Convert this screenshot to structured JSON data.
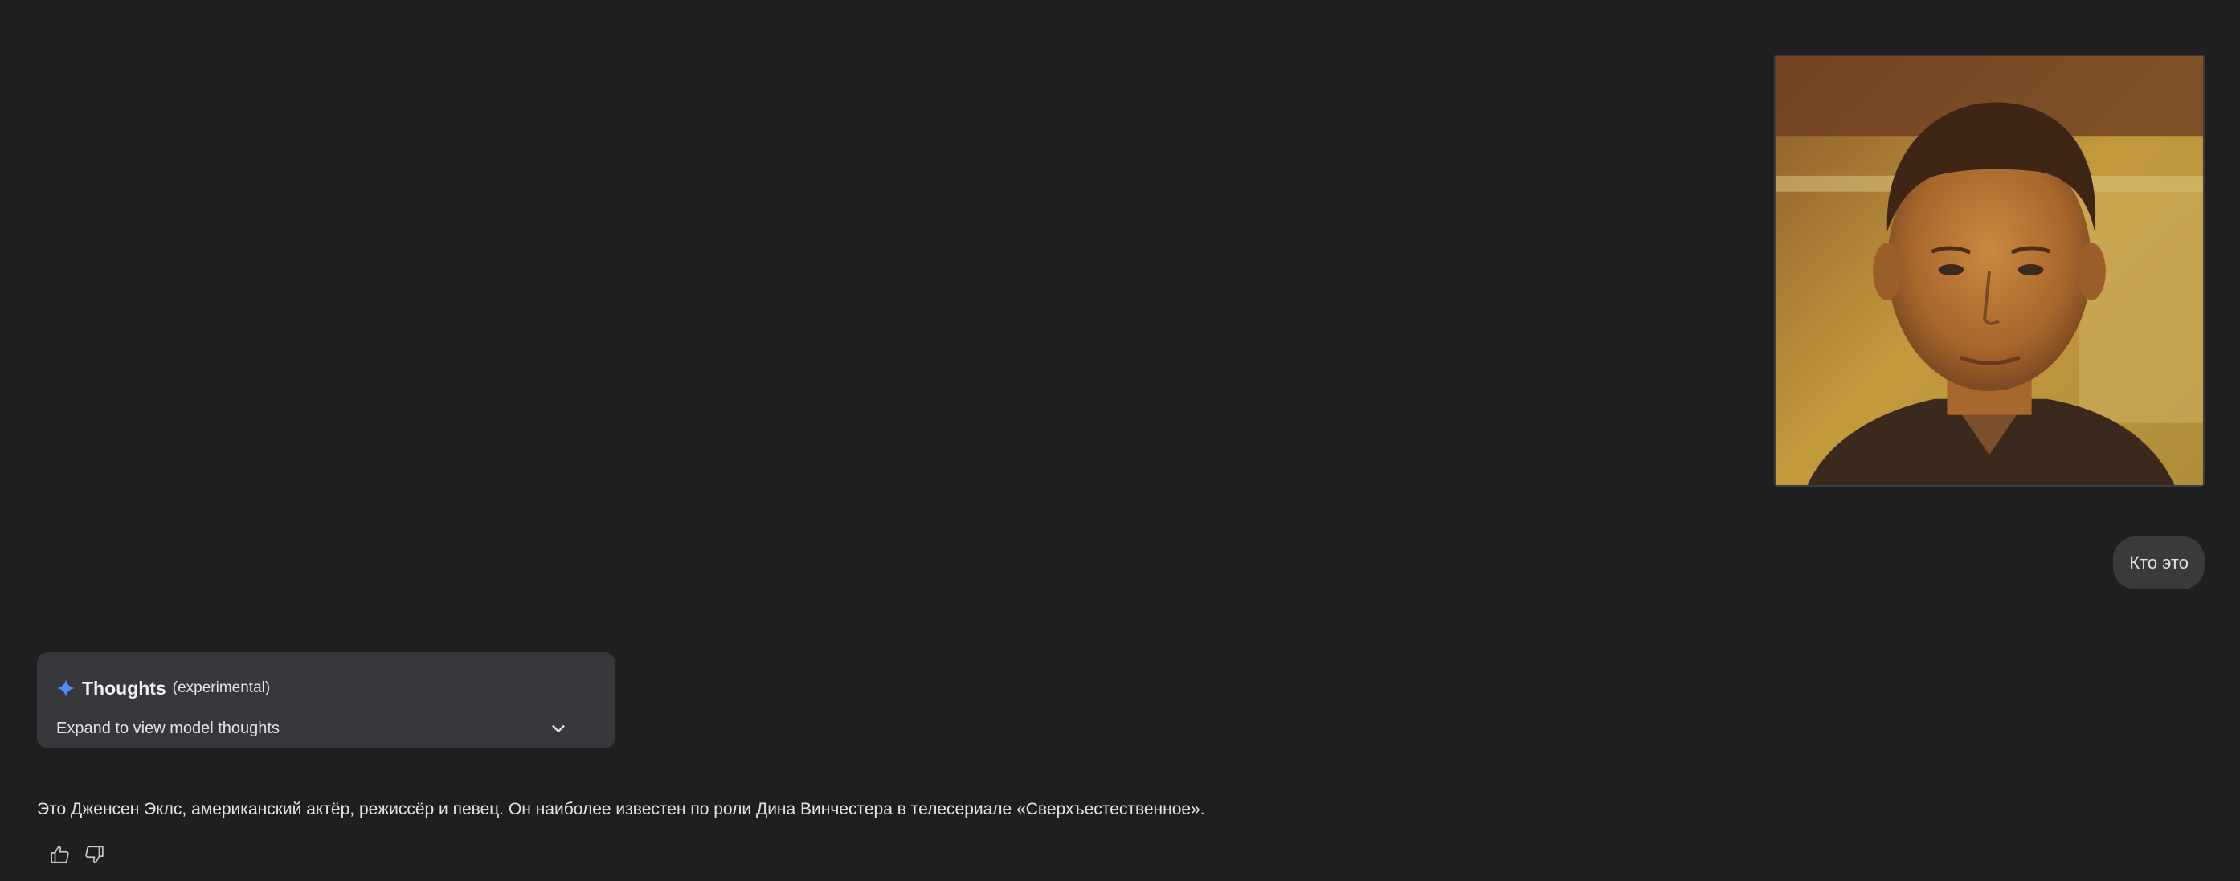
{
  "conversation": {
    "user_message": {
      "image": {
        "alt": "uploaded photo of a man"
      },
      "text": "Кто это"
    },
    "model_response": {
      "thoughts": {
        "title": "Thoughts",
        "tag": "(experimental)",
        "expand_label": "Expand to view model thoughts",
        "icon": "sparkle-icon",
        "icon_color": "#4c8df6"
      },
      "answer_text": "Это Дженсен Эклс, американский актёр, режиссёр и певец. Он наиболее известен по роли Дина Винчестера в телесериале «Сверхъестественное».",
      "actions": [
        {
          "name": "thumbs-up",
          "icon": "thumb-up-icon"
        },
        {
          "name": "thumbs-down",
          "icon": "thumb-down-icon"
        }
      ]
    }
  },
  "theme": {
    "background": "#1f1f1f",
    "bubble": "#3a3a3c",
    "panel": "#37383b",
    "text": "#e3e3e3"
  }
}
